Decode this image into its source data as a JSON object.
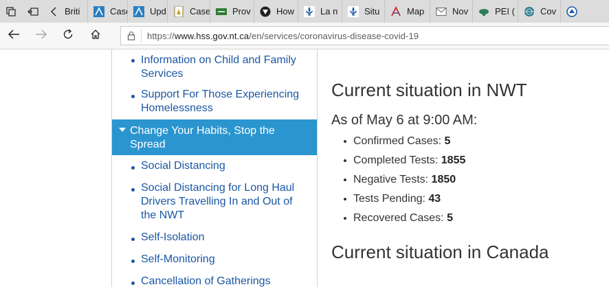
{
  "browser": {
    "tabs": [
      {
        "title": "Briti",
        "icon": "blank-icon"
      },
      {
        "title": "Case",
        "icon": "ab-flag-icon"
      },
      {
        "title": "Upd",
        "icon": "ab-flag-icon"
      },
      {
        "title": "Case",
        "icon": "bc-crest-icon"
      },
      {
        "title": "Prov",
        "icon": "green-banner-icon"
      },
      {
        "title": "How",
        "icon": "dark-shield-icon"
      },
      {
        "title": "La n",
        "icon": "fleur-de-lis-icon"
      },
      {
        "title": "Situ",
        "icon": "fleur-de-lis-icon"
      },
      {
        "title": "Map",
        "icon": "red-logo-icon"
      },
      {
        "title": "Nov",
        "icon": "document-icon"
      },
      {
        "title": "PEI (",
        "icon": "pei-icon"
      },
      {
        "title": "Cov",
        "icon": "globe-icon"
      }
    ],
    "url_prefix": "https://",
    "url_host": "www.hss.gov.nt.ca",
    "url_path": "/en/services/coronavirus-disease-covid-19"
  },
  "sidebar": {
    "items_above": [
      "Information on Child and Family Services",
      "Support For Those Experiencing Homelessness"
    ],
    "active": "Change Your Habits, Stop the Spread",
    "items_below": [
      "Social Distancing",
      "Social Distancing for Long Haul Drivers Travelling In and Out of the NWT",
      "Self-Isolation",
      "Self-Monitoring",
      "Cancellation of Gatherings"
    ]
  },
  "main": {
    "heading_nwt": "Current situation in NWT",
    "as_of": "As of May 6 at 9:00 AM:",
    "stats": [
      {
        "label": "Confirmed Cases:",
        "value": "5"
      },
      {
        "label": "Completed Tests:",
        "value": "1855"
      },
      {
        "label": "Negative Tests:",
        "value": "1850"
      },
      {
        "label": "Tests Pending:",
        "value": "43"
      },
      {
        "label": "Recovered Cases:",
        "value": "5"
      }
    ],
    "heading_canada": "Current situation in Canada"
  }
}
